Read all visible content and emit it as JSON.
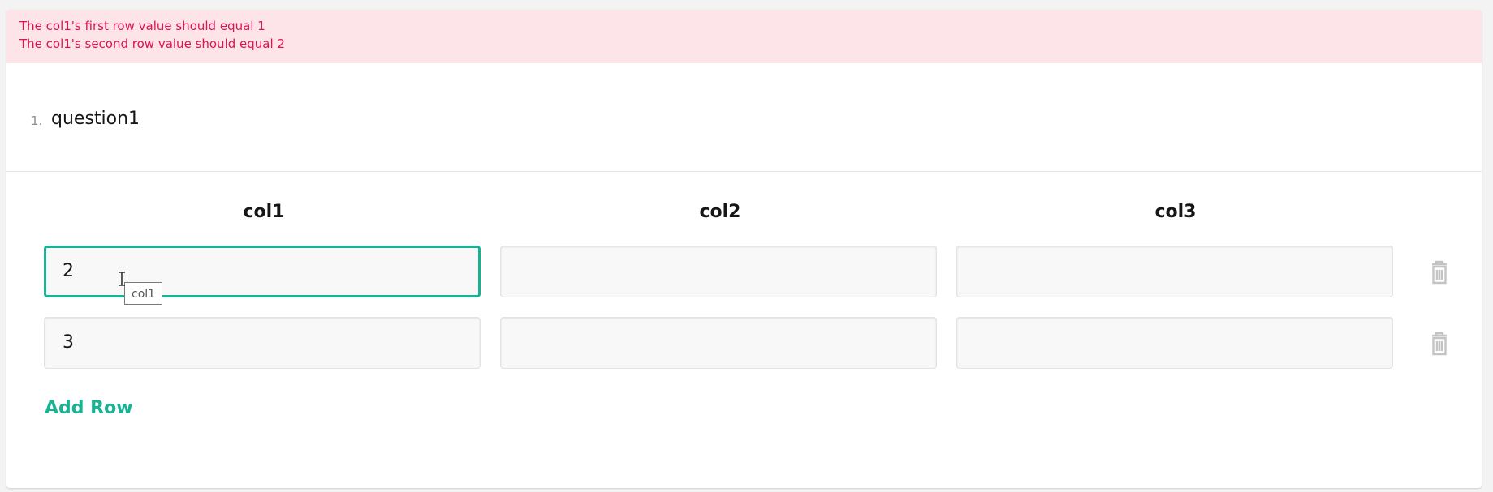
{
  "errors": {
    "line1": "The col1's first row value should equal 1",
    "line2": "The col1's second row value should equal 2"
  },
  "question": {
    "number": "1.",
    "title": "question1"
  },
  "columns": [
    "col1",
    "col2",
    "col3"
  ],
  "rows": [
    {
      "col1": "2",
      "col2": "",
      "col3": ""
    },
    {
      "col1": "3",
      "col2": "",
      "col3": ""
    }
  ],
  "add_row_label": "Add Row",
  "tooltip": "col1",
  "icons": {
    "delete": "trash-icon",
    "cursor": "text-cursor-icon"
  },
  "colors": {
    "accent": "#19b394",
    "error_text": "#e4104f",
    "error_bg": "#fde4e9"
  }
}
